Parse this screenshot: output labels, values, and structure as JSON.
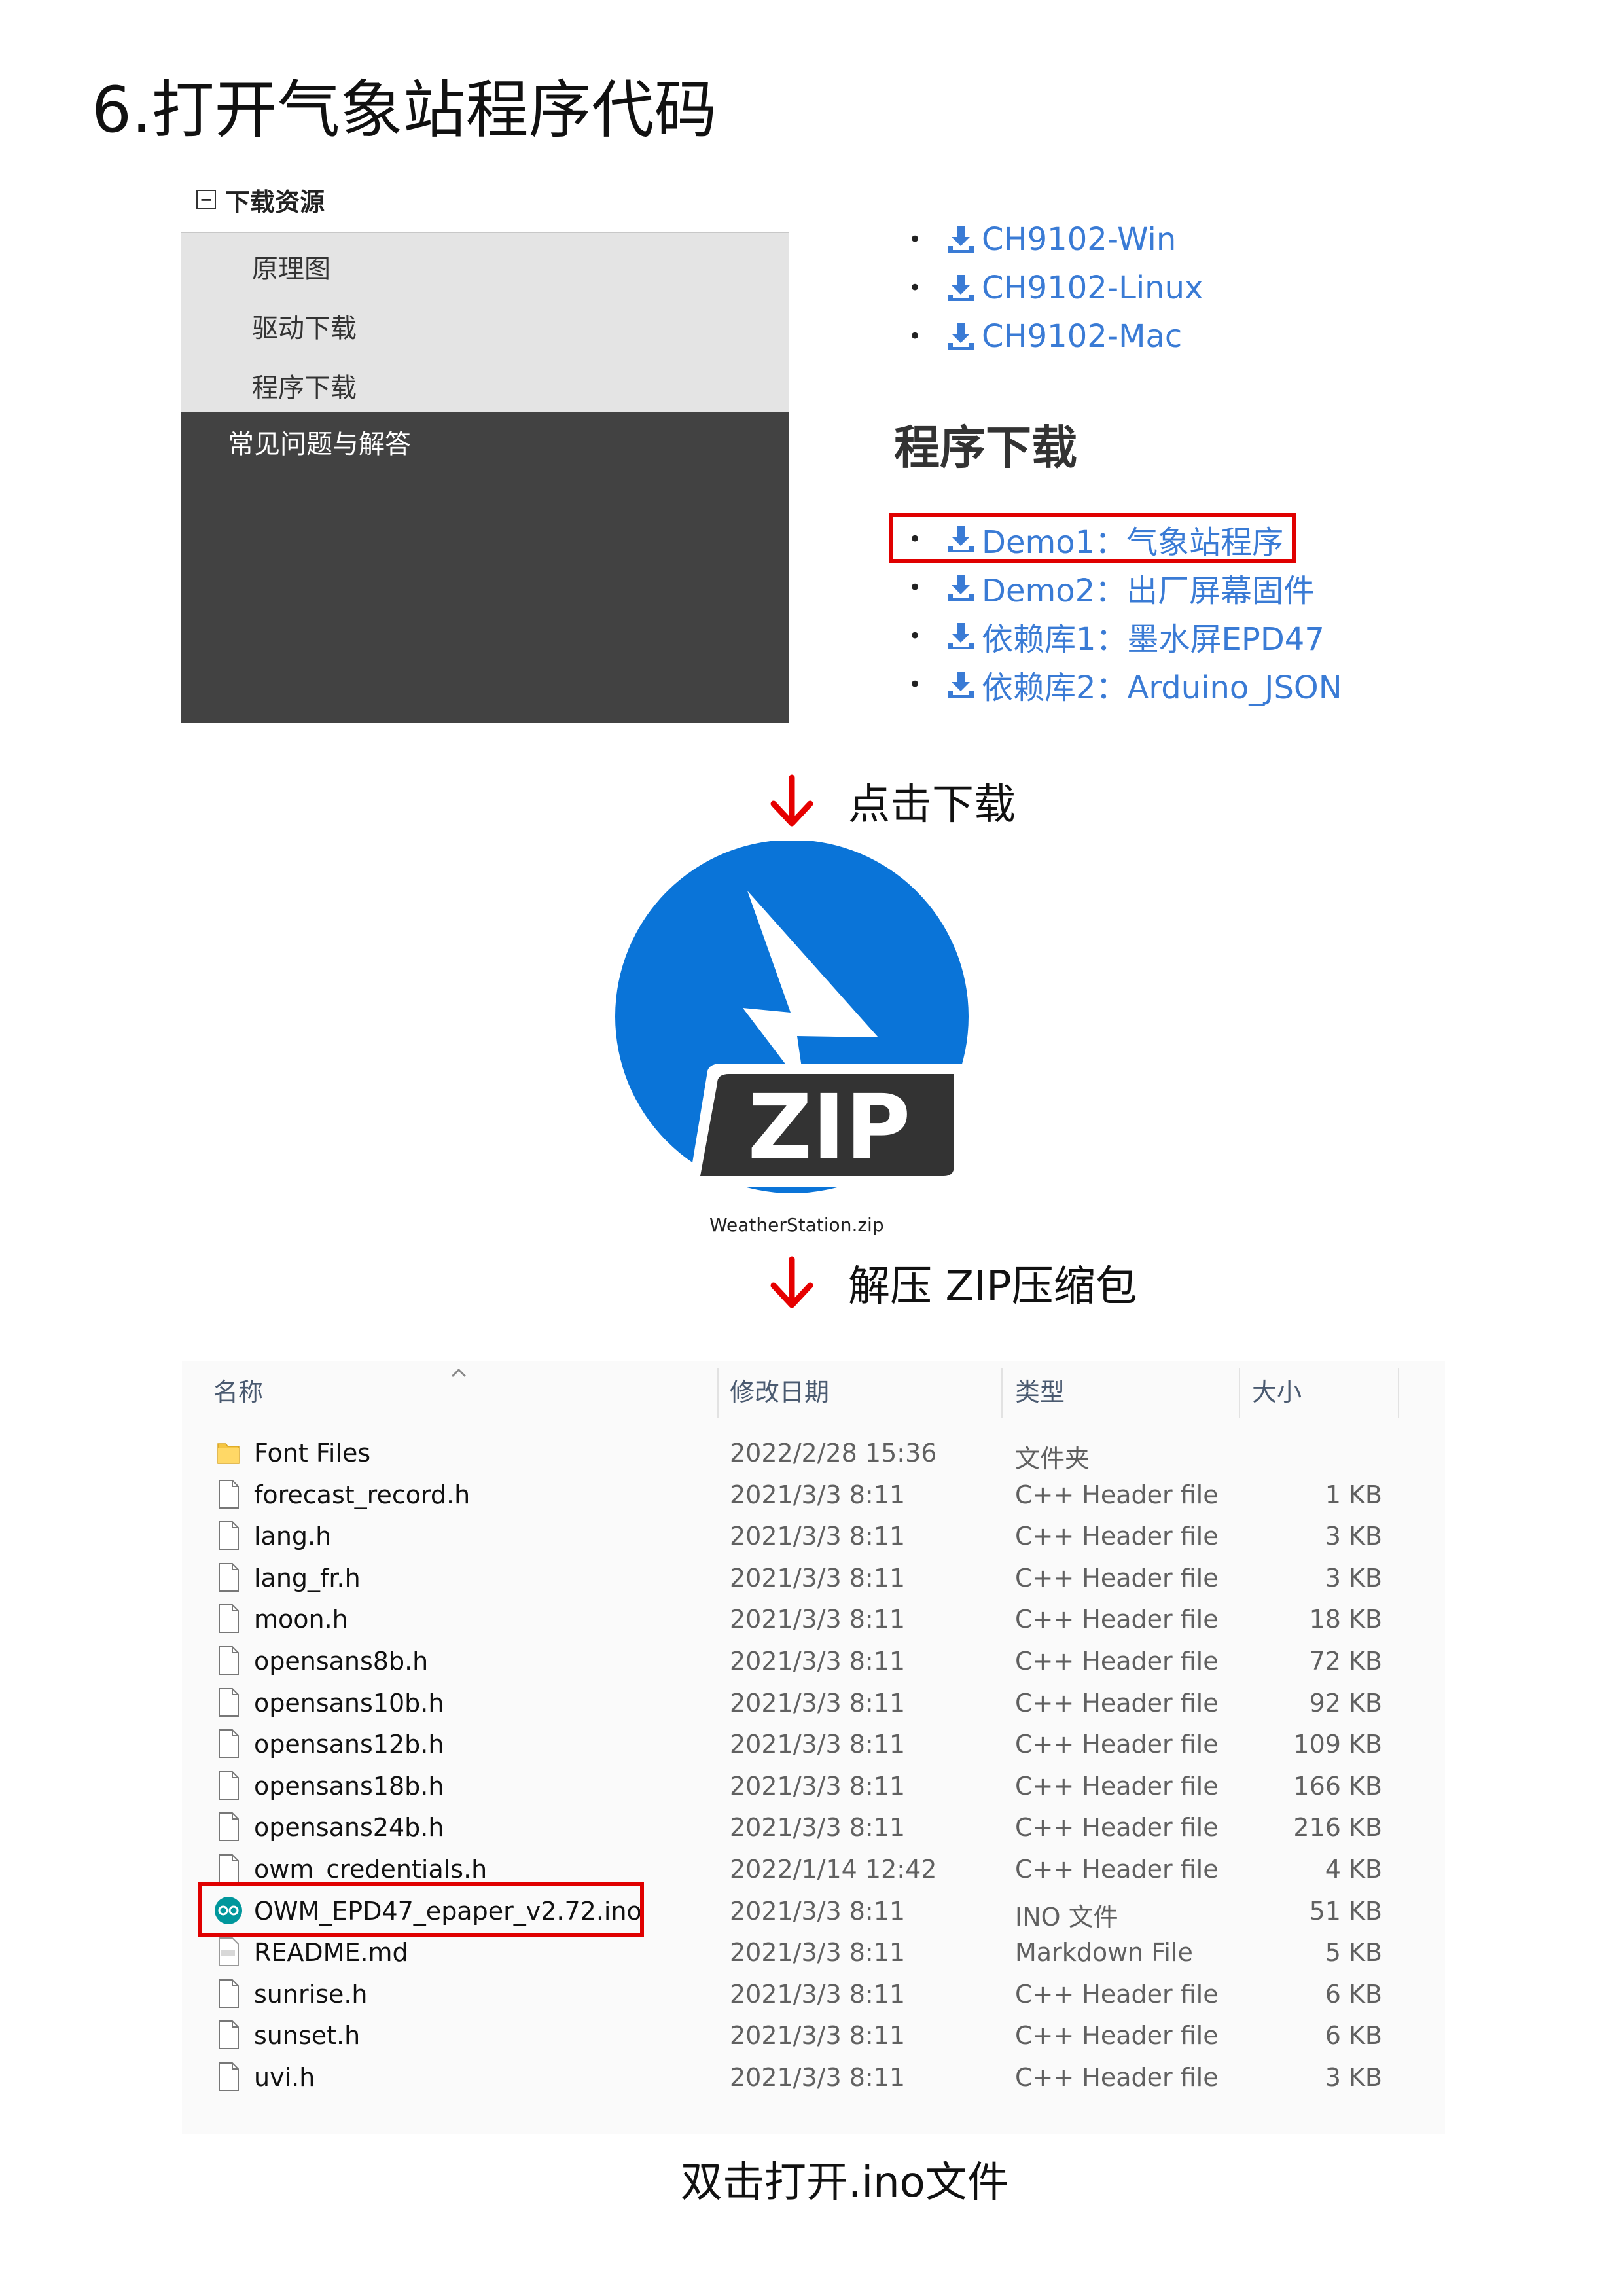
{
  "title": "6.打开气象站程序代码",
  "nav": {
    "header": "下载资源",
    "collapse_symbol": "−",
    "items": [
      "原理图",
      "驱动下载",
      "程序下载"
    ],
    "faq": "常见问题与解答"
  },
  "drivers": [
    "CH9102-Win",
    "CH9102-Linux",
    "CH9102-Mac"
  ],
  "program_section": {
    "heading": "程序下载",
    "links": [
      "Demo1：气象站程序",
      "Demo2：出厂屏幕固件",
      "依赖库1：墨水屏EPD47",
      "依赖库2：Arduino_JSON"
    ]
  },
  "step1": "点击下载",
  "zip": {
    "badge": "ZIP",
    "filename": "WeatherStation.zip"
  },
  "step2": "解压 ZIP压缩包",
  "explorer": {
    "columns": [
      "名称",
      "修改日期",
      "类型",
      "大小"
    ],
    "files": [
      {
        "name": "Font Files",
        "date": "2022/2/28 15:36",
        "type": "文件夹",
        "size": "",
        "icon": "folder-icon"
      },
      {
        "name": "forecast_record.h",
        "date": "2021/3/3 8:11",
        "type": "C++ Header file",
        "size": "1 KB",
        "icon": "file-icon"
      },
      {
        "name": "lang.h",
        "date": "2021/3/3 8:11",
        "type": "C++ Header file",
        "size": "3 KB",
        "icon": "file-icon"
      },
      {
        "name": "lang_fr.h",
        "date": "2021/3/3 8:11",
        "type": "C++ Header file",
        "size": "3 KB",
        "icon": "file-icon"
      },
      {
        "name": "moon.h",
        "date": "2021/3/3 8:11",
        "type": "C++ Header file",
        "size": "18 KB",
        "icon": "file-icon"
      },
      {
        "name": "opensans8b.h",
        "date": "2021/3/3 8:11",
        "type": "C++ Header file",
        "size": "72 KB",
        "icon": "file-icon"
      },
      {
        "name": "opensans10b.h",
        "date": "2021/3/3 8:11",
        "type": "C++ Header file",
        "size": "92 KB",
        "icon": "file-icon"
      },
      {
        "name": "opensans12b.h",
        "date": "2021/3/3 8:11",
        "type": "C++ Header file",
        "size": "109 KB",
        "icon": "file-icon"
      },
      {
        "name": "opensans18b.h",
        "date": "2021/3/3 8:11",
        "type": "C++ Header file",
        "size": "166 KB",
        "icon": "file-icon"
      },
      {
        "name": "opensans24b.h",
        "date": "2021/3/3 8:11",
        "type": "C++ Header file",
        "size": "216 KB",
        "icon": "file-icon"
      },
      {
        "name": "owm_credentials.h",
        "date": "2022/1/14 12:42",
        "type": "C++ Header file",
        "size": "4 KB",
        "icon": "file-icon"
      },
      {
        "name": "OWM_EPD47_epaper_v2.72.ino",
        "date": "2021/3/3 8:11",
        "type": "INO 文件",
        "size": "51 KB",
        "icon": "arduino-icon"
      },
      {
        "name": "README.md",
        "date": "2021/3/3 8:11",
        "type": "Markdown File",
        "size": "5 KB",
        "icon": "markdown-file-icon"
      },
      {
        "name": "sunrise.h",
        "date": "2021/3/3 8:11",
        "type": "C++ Header file",
        "size": "6 KB",
        "icon": "file-icon"
      },
      {
        "name": "sunset.h",
        "date": "2021/3/3 8:11",
        "type": "C++ Header file",
        "size": "6 KB",
        "icon": "file-icon"
      },
      {
        "name": "uvi.h",
        "date": "2021/3/3 8:11",
        "type": "C++ Header file",
        "size": "3 KB",
        "icon": "file-icon"
      }
    ]
  },
  "footer": "双击打开.ino文件",
  "colors": {
    "link": "#3a7bd5",
    "highlight": "#e00000",
    "arrow": "#e60000",
    "zip_blue": "#0a74d8",
    "nav_dark": "#424242",
    "nav_light": "#e4e4e4"
  }
}
